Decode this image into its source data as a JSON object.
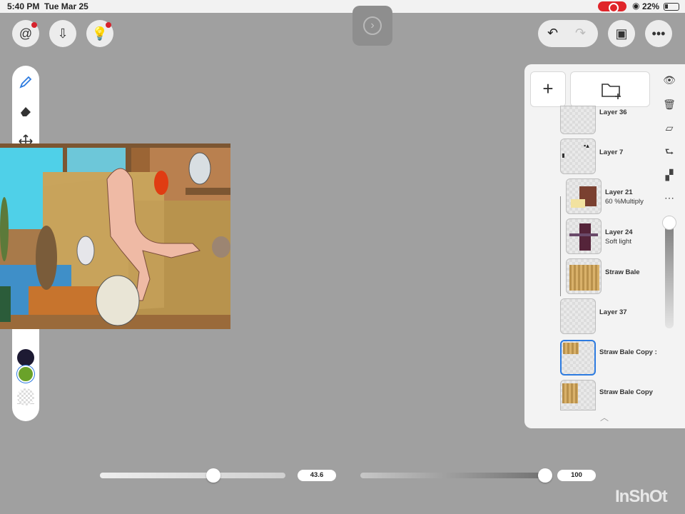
{
  "status_bar": {
    "time": "5:40 PM",
    "date": "Tue Mar 25",
    "battery": "22%"
  },
  "bottom": {
    "brush_size": "43.6",
    "opacity": "100",
    "brush_size_fraction": 0.61,
    "opacity_fraction": 1.0
  },
  "layers": [
    {
      "name": "Layer 36",
      "sub": ""
    },
    {
      "name": "Layer 7",
      "sub": ""
    },
    {
      "name": "Layer 21",
      "sub": "60 %Multiply"
    },
    {
      "name": "Layer 24",
      "sub": "Soft light"
    },
    {
      "name": "Straw Bale",
      "sub": ""
    },
    {
      "name": "Layer 37",
      "sub": ""
    },
    {
      "name": "Straw Bale Copy :",
      "sub": ""
    },
    {
      "name": "Straw Bale Copy",
      "sub": ""
    }
  ],
  "colors": {
    "primary": "#1d1a33",
    "secondary": "#6aa22a",
    "selection": "#2d7be0",
    "accent_red": "#d6222c"
  },
  "watermark": "InShOt"
}
